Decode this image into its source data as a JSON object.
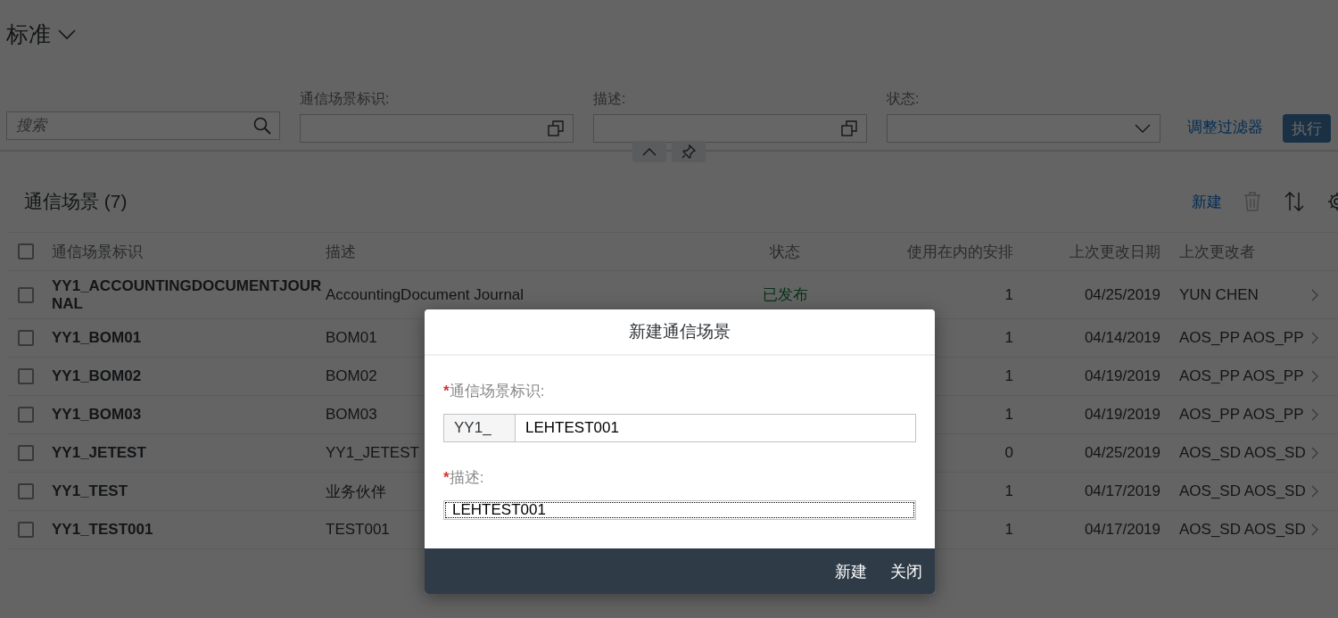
{
  "variant": {
    "title": "标准"
  },
  "filter_bar": {
    "search": {
      "placeholder": "搜索"
    },
    "fields": [
      {
        "label": "通信场景标识:",
        "kind": "valuehelp"
      },
      {
        "label": "描述:",
        "kind": "valuehelp"
      },
      {
        "label": "状态:",
        "kind": "select"
      }
    ],
    "adapt_link": "调整过滤器",
    "go_button": "执行"
  },
  "table": {
    "title": "通信场景 (7)",
    "toolbar_button": "新建",
    "select_all": {
      "checked": false
    },
    "columns": [
      "通信场景标识",
      "描述",
      "状态",
      "使用在内的安排",
      "上次更改日期",
      "上次更改者"
    ],
    "rows": [
      {
        "id": "YY1_ACCOUNTINGDOCUMENTJOURNAL",
        "description": "AccountingDocument Journal",
        "status": "已发布",
        "usage": "1",
        "date": "04/25/2019",
        "changed_by": "YUN CHEN",
        "selected": false
      },
      {
        "id": "YY1_BOM01",
        "description": "BOM01",
        "usage": "1",
        "date": "04/14/2019",
        "changed_by": "AOS_PP AOS_PP",
        "selected": false
      },
      {
        "id": "YY1_BOM02",
        "description": "BOM02",
        "usage": "1",
        "date": "04/19/2019",
        "changed_by": "AOS_PP AOS_PP",
        "selected": false
      },
      {
        "id": "YY1_BOM03",
        "description": "BOM03",
        "usage": "1",
        "date": "04/19/2019",
        "changed_by": "AOS_PP AOS_PP",
        "selected": false
      },
      {
        "id": "YY1_JETEST",
        "description": "YY1_JETEST",
        "usage": "0",
        "date": "04/25/2019",
        "changed_by": "AOS_SD AOS_SD",
        "selected": false
      },
      {
        "id": "YY1_TEST",
        "description": "业务伙伴",
        "usage": "1",
        "date": "04/17/2019",
        "changed_by": "AOS_SD AOS_SD",
        "selected": false
      },
      {
        "id": "YY1_TEST001",
        "description": "TEST001",
        "usage": "1",
        "date": "04/17/2019",
        "changed_by": "AOS_SD AOS_SD",
        "selected": false
      }
    ]
  },
  "dialog": {
    "title": "新建通信场景",
    "fields": [
      {
        "label": "通信场景标识:",
        "required": true,
        "required_mark": "*",
        "prefix": "YY1_",
        "value": "LEHTEST001",
        "focused": false
      },
      {
        "label": "描述:",
        "required": true,
        "required_mark": "*",
        "value": "LEHTEST001",
        "focused": true
      }
    ],
    "buttons": [
      "新建",
      "关闭"
    ]
  }
}
